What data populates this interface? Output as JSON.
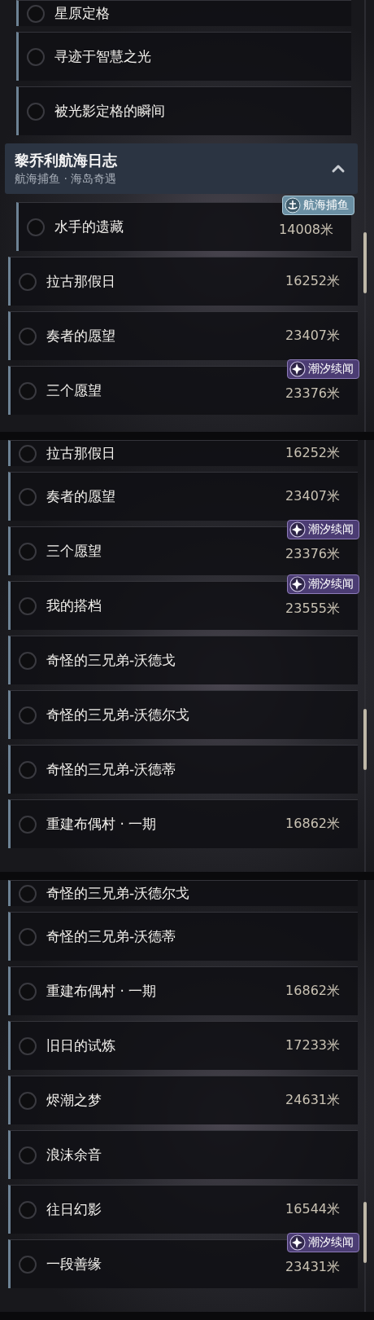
{
  "panels": [
    {
      "items": [
        {
          "kind": "quest",
          "title": "星原定格",
          "indented": true
        },
        {
          "kind": "quest",
          "title": "寻迹于智慧之光",
          "indented": true
        },
        {
          "kind": "quest",
          "title": "被光影定格的瞬间",
          "indented": true
        },
        {
          "kind": "group",
          "title": "黎乔利航海日志",
          "subtitle": "航海捕鱼 · 海岛奇遇",
          "expanded": true
        },
        {
          "kind": "quest",
          "title": "水手的遗藏",
          "distance": "14008米",
          "tag": {
            "kind": "fishing",
            "label": "航海捕鱼"
          },
          "indented": true
        },
        {
          "kind": "quest",
          "title": "拉古那假日",
          "distance": "16252米",
          "indented": false
        },
        {
          "kind": "quest",
          "title": "奏者的愿望",
          "distance": "23407米",
          "indented": false
        },
        {
          "kind": "quest",
          "title": "三个愿望",
          "distance": "23376米",
          "tag": {
            "kind": "tide",
            "label": "潮汐续闻"
          },
          "indented": false
        }
      ]
    },
    {
      "items": [
        {
          "kind": "quest",
          "title": "拉古那假日",
          "distance": "16252米",
          "indented": false
        },
        {
          "kind": "quest",
          "title": "奏者的愿望",
          "distance": "23407米",
          "indented": false
        },
        {
          "kind": "quest",
          "title": "三个愿望",
          "distance": "23376米",
          "tag": {
            "kind": "tide",
            "label": "潮汐续闻"
          },
          "indented": false
        },
        {
          "kind": "quest",
          "title": "我的搭档",
          "distance": "23555米",
          "tag": {
            "kind": "tide",
            "label": "潮汐续闻"
          },
          "indented": false
        },
        {
          "kind": "quest",
          "title": "奇怪的三兄弟-沃德戈",
          "indented": false
        },
        {
          "kind": "quest",
          "title": "奇怪的三兄弟-沃德尔戈",
          "indented": false
        },
        {
          "kind": "quest",
          "title": "奇怪的三兄弟-沃德蒂",
          "indented": false
        },
        {
          "kind": "quest",
          "title": "重建布偶村 · 一期",
          "distance": "16862米",
          "indented": false
        }
      ]
    },
    {
      "items": [
        {
          "kind": "quest",
          "title": "奇怪的三兄弟-沃德尔戈",
          "indented": false
        },
        {
          "kind": "quest",
          "title": "奇怪的三兄弟-沃德蒂",
          "indented": false
        },
        {
          "kind": "quest",
          "title": "重建布偶村 · 一期",
          "distance": "16862米",
          "indented": false
        },
        {
          "kind": "quest",
          "title": "旧日的试炼",
          "distance": "17233米",
          "indented": false
        },
        {
          "kind": "quest",
          "title": "烬潮之梦",
          "distance": "24631米",
          "indented": false
        },
        {
          "kind": "quest",
          "title": "浪沫余音",
          "indented": false
        },
        {
          "kind": "quest",
          "title": "往日幻影",
          "distance": "16544米",
          "indented": false
        },
        {
          "kind": "quest",
          "title": "一段善缘",
          "distance": "23431米",
          "tag": {
            "kind": "tide",
            "label": "潮汐续闻"
          },
          "indented": false
        }
      ]
    }
  ]
}
